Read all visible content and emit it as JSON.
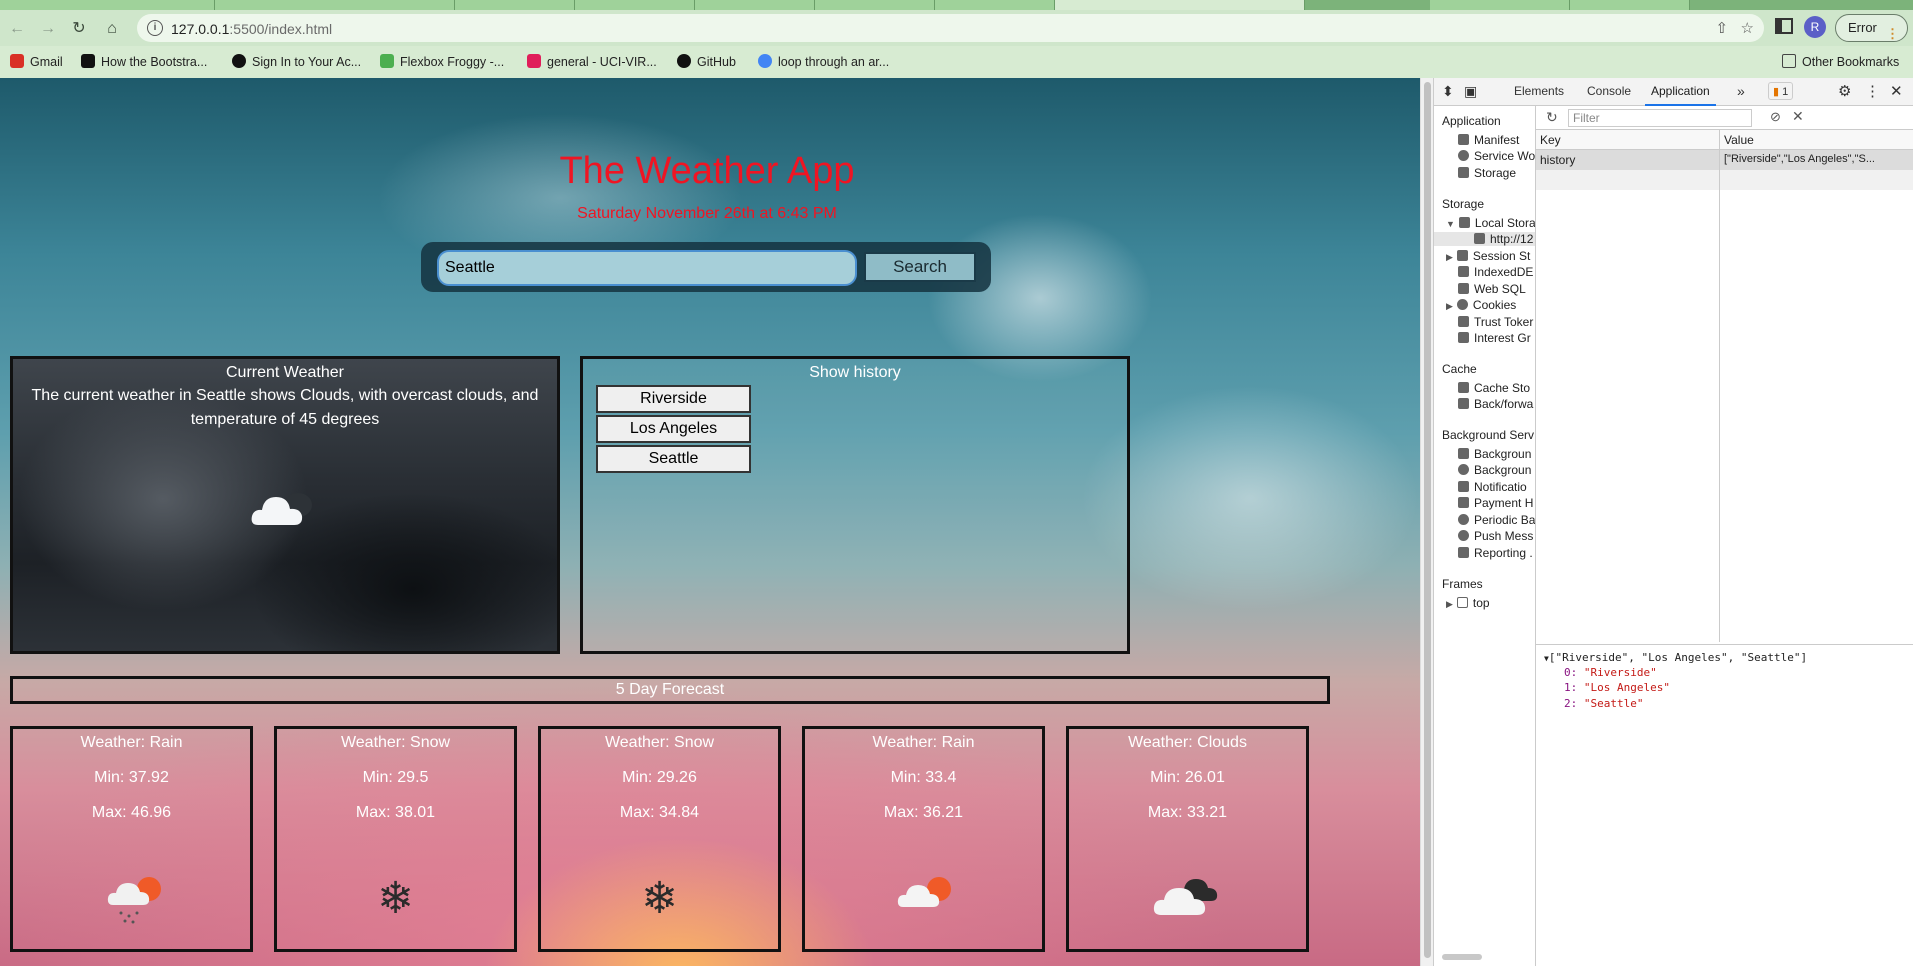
{
  "browser": {
    "url_host": "127.0.0.1",
    "url_rest": ":5500/index.html",
    "profile_initial": "R",
    "error_label": "Error",
    "bookmarks": [
      {
        "label": "Gmail",
        "color": "#d93025"
      },
      {
        "label": "How the Bootstra...",
        "color": "#111111"
      },
      {
        "label": "Sign In to Your Ac...",
        "color": "#111111"
      },
      {
        "label": "Flexbox Froggy -...",
        "color": "#4caf50"
      },
      {
        "label": "general - UCI-VIR...",
        "color": "#e01e5a"
      },
      {
        "label": "GitHub",
        "color": "#111111"
      },
      {
        "label": "loop through an ar...",
        "color": "#4285f4"
      }
    ],
    "other_bookmarks": "Other Bookmarks"
  },
  "app": {
    "title": "The Weather App",
    "date": "Saturday November 26th at 6:43 PM",
    "search_value": "Seattle",
    "search_button": "Search",
    "title_color": "#ef1523"
  },
  "current": {
    "heading": "Current Weather",
    "description": "The current weather in Seattle shows Clouds, with overcast clouds, and temperature of 45 degrees",
    "icon": "cloud-icon"
  },
  "history": {
    "heading": "Show history",
    "items": [
      "Riverside",
      "Los Angeles",
      "Seattle"
    ]
  },
  "forecast": {
    "heading": "5 Day Forecast",
    "days": [
      {
        "weather": "Weather: Rain",
        "min": "Min: 37.92",
        "max": "Max: 46.96",
        "icon": "rain-cloud-sun-icon"
      },
      {
        "weather": "Weather: Snow",
        "min": "Min: 29.5",
        "max": "Max: 38.01",
        "icon": "snowflake-icon"
      },
      {
        "weather": "Weather: Snow",
        "min": "Min: 29.26",
        "max": "Max: 34.84",
        "icon": "snowflake-icon"
      },
      {
        "weather": "Weather: Rain",
        "min": "Min: 33.4",
        "max": "Max: 36.21",
        "icon": "cloud-sun-icon"
      },
      {
        "weather": "Weather: Clouds",
        "min": "Min: 26.01",
        "max": "Max: 33.21",
        "icon": "dark-clouds-icon"
      }
    ]
  },
  "devtools": {
    "tabs": [
      "Elements",
      "Console",
      "Application"
    ],
    "active_tab": "Application",
    "issues_count": "1",
    "sections": {
      "application": "Application",
      "application_items": [
        "Manifest",
        "Service Wo",
        "Storage"
      ],
      "storage": "Storage",
      "storage_items": [
        "Local Stora",
        "http://12",
        "Session St",
        "IndexedDE",
        "Web SQL",
        "Cookies",
        "Trust Toker",
        "Interest Gr"
      ],
      "cache": "Cache",
      "cache_items": [
        "Cache Sto",
        "Back/forwa"
      ],
      "background": "Background Serv",
      "background_items": [
        "Backgroun",
        "Backgroun",
        "Notificatio",
        "Payment H",
        "Periodic Ba",
        "Push Mess",
        "Reporting ."
      ],
      "frames": "Frames",
      "frames_items": [
        "top"
      ]
    },
    "filter_placeholder": "Filter",
    "table": {
      "key_header": "Key",
      "value_header": "Value",
      "rows": [
        {
          "key": "history",
          "value": "[\"Riverside\",\"Los Angeles\",\"S..."
        }
      ]
    },
    "preview": {
      "summary": "[\"Riverside\", \"Los Angeles\", \"Seattle\"]",
      "entries": [
        {
          "index": "0:",
          "value": "\"Riverside\""
        },
        {
          "index": "1:",
          "value": "\"Los Angeles\""
        },
        {
          "index": "2:",
          "value": "\"Seattle\""
        }
      ]
    }
  }
}
